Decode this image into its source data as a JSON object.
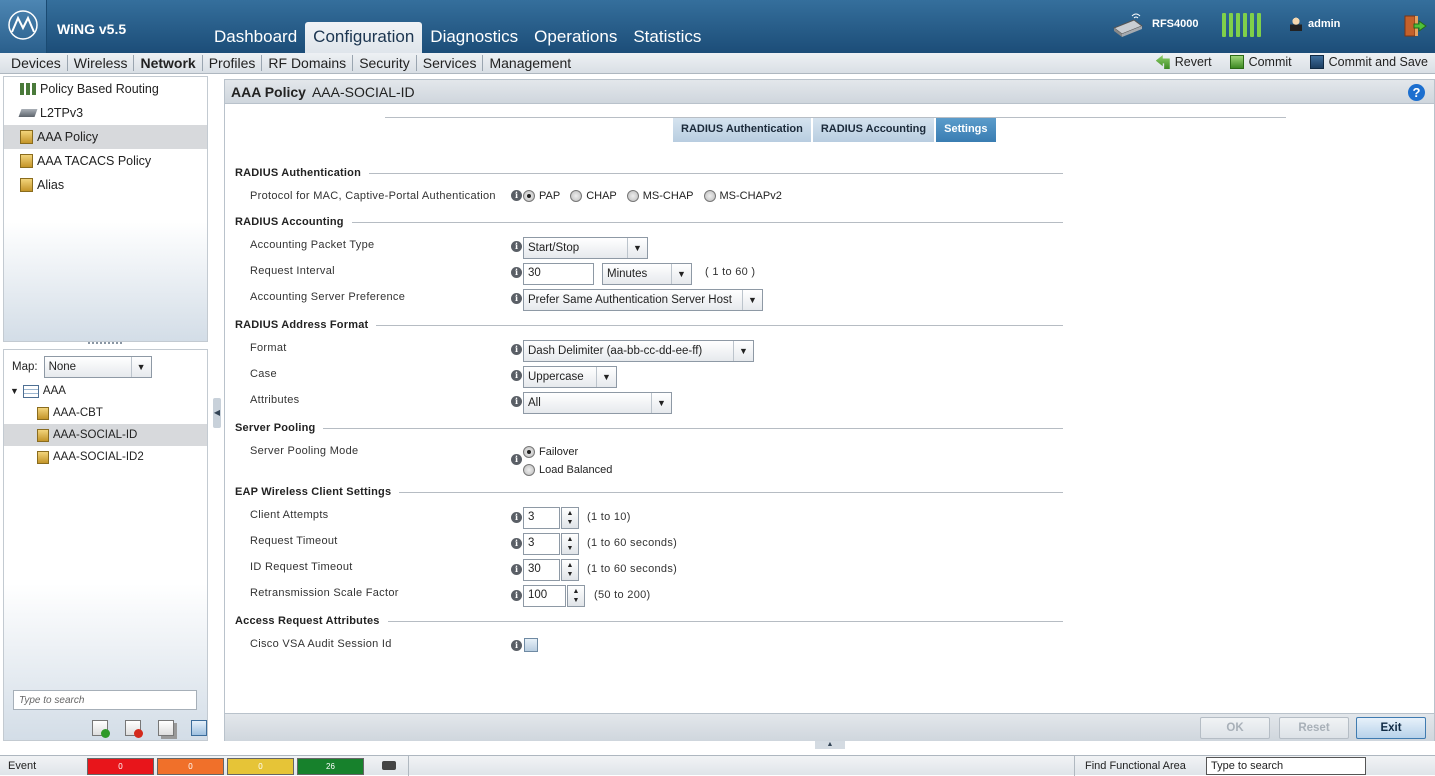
{
  "app": {
    "product": "WiNG v5.5"
  },
  "main_tabs": [
    "Dashboard",
    "Configuration",
    "Diagnostics",
    "Operations",
    "Statistics"
  ],
  "device": {
    "name": "RFS4000"
  },
  "user": {
    "name": "admin"
  },
  "subnav": [
    "Devices",
    "Wireless",
    "Network",
    "Profiles",
    "RF Domains",
    "Security",
    "Services",
    "Management"
  ],
  "actions": {
    "revert": "Revert",
    "commit": "Commit",
    "commit_save": "Commit and Save"
  },
  "left_tree": [
    {
      "label": "Policy Based Routing",
      "icon": "routing-icon"
    },
    {
      "label": "L2TPv3",
      "icon": "tunnel-icon"
    },
    {
      "label": "AAA Policy",
      "icon": "policy-icon"
    },
    {
      "label": "AAA TACACS Policy",
      "icon": "policy-icon"
    },
    {
      "label": "Alias",
      "icon": "policy-icon"
    }
  ],
  "map": {
    "label": "Map:",
    "value": "None"
  },
  "aaa_tree": {
    "root": "AAA",
    "children": [
      "AAA-CBT",
      "AAA-SOCIAL-ID",
      "AAA-SOCIAL-ID2"
    ]
  },
  "left_search_placeholder": "Type to search",
  "page": {
    "title": "AAA Policy",
    "name": "AAA-SOCIAL-ID"
  },
  "policy_tabs": [
    "RADIUS Authentication",
    "RADIUS Accounting",
    "Settings"
  ],
  "sections": {
    "radius_auth": "RADIUS Authentication",
    "radius_acct": "RADIUS Accounting",
    "addr_format": "RADIUS Address Format",
    "server_pooling": "Server Pooling",
    "eap": "EAP Wireless Client Settings",
    "access_req": "Access Request Attributes"
  },
  "fields": {
    "protocol": {
      "label": "Protocol for MAC, Captive-Portal Authentication",
      "options": [
        "PAP",
        "CHAP",
        "MS-CHAP",
        "MS-CHAPv2"
      ],
      "selected": "PAP"
    },
    "acct_packet_type": {
      "label": "Accounting Packet Type",
      "value": "Start/Stop"
    },
    "request_interval": {
      "label": "Request Interval",
      "value": "30",
      "unit": "Minutes",
      "hint": "( 1 to 60 )"
    },
    "acct_server_pref": {
      "label": "Accounting Server Preference",
      "value": "Prefer Same Authentication Server Host"
    },
    "format": {
      "label": "Format",
      "value": "Dash Delimiter (aa-bb-cc-dd-ee-ff)"
    },
    "case": {
      "label": "Case",
      "value": "Uppercase"
    },
    "attributes": {
      "label": "Attributes",
      "value": "All"
    },
    "pooling_mode": {
      "label": "Server Pooling Mode",
      "options": [
        "Failover",
        "Load Balanced"
      ],
      "selected": "Failover"
    },
    "client_attempts": {
      "label": "Client Attempts",
      "value": "3",
      "hint": "(1 to 10)"
    },
    "request_timeout": {
      "label": "Request Timeout",
      "value": "3",
      "hint": "(1 to 60 seconds)"
    },
    "id_request_timeout": {
      "label": "ID Request Timeout",
      "value": "30",
      "hint": "(1 to 60 seconds)"
    },
    "retrans_scale": {
      "label": "Retransmission Scale Factor",
      "value": "100",
      "hint": "(50 to 200)"
    },
    "cisco_vsa": {
      "label": "Cisco VSA Audit Session Id",
      "checked": false
    }
  },
  "footer": {
    "ok": "OK",
    "reset": "Reset",
    "exit": "Exit"
  },
  "status": {
    "event_label": "Event",
    "counts": [
      {
        "value": "0",
        "color": "#e8151b"
      },
      {
        "value": "0",
        "color": "#f0702a"
      },
      {
        "value": "0",
        "color": "#e6c437"
      },
      {
        "value": "26",
        "color": "#17812c"
      }
    ],
    "find_label": "Find Functional Area",
    "find_placeholder": "Type to search"
  }
}
